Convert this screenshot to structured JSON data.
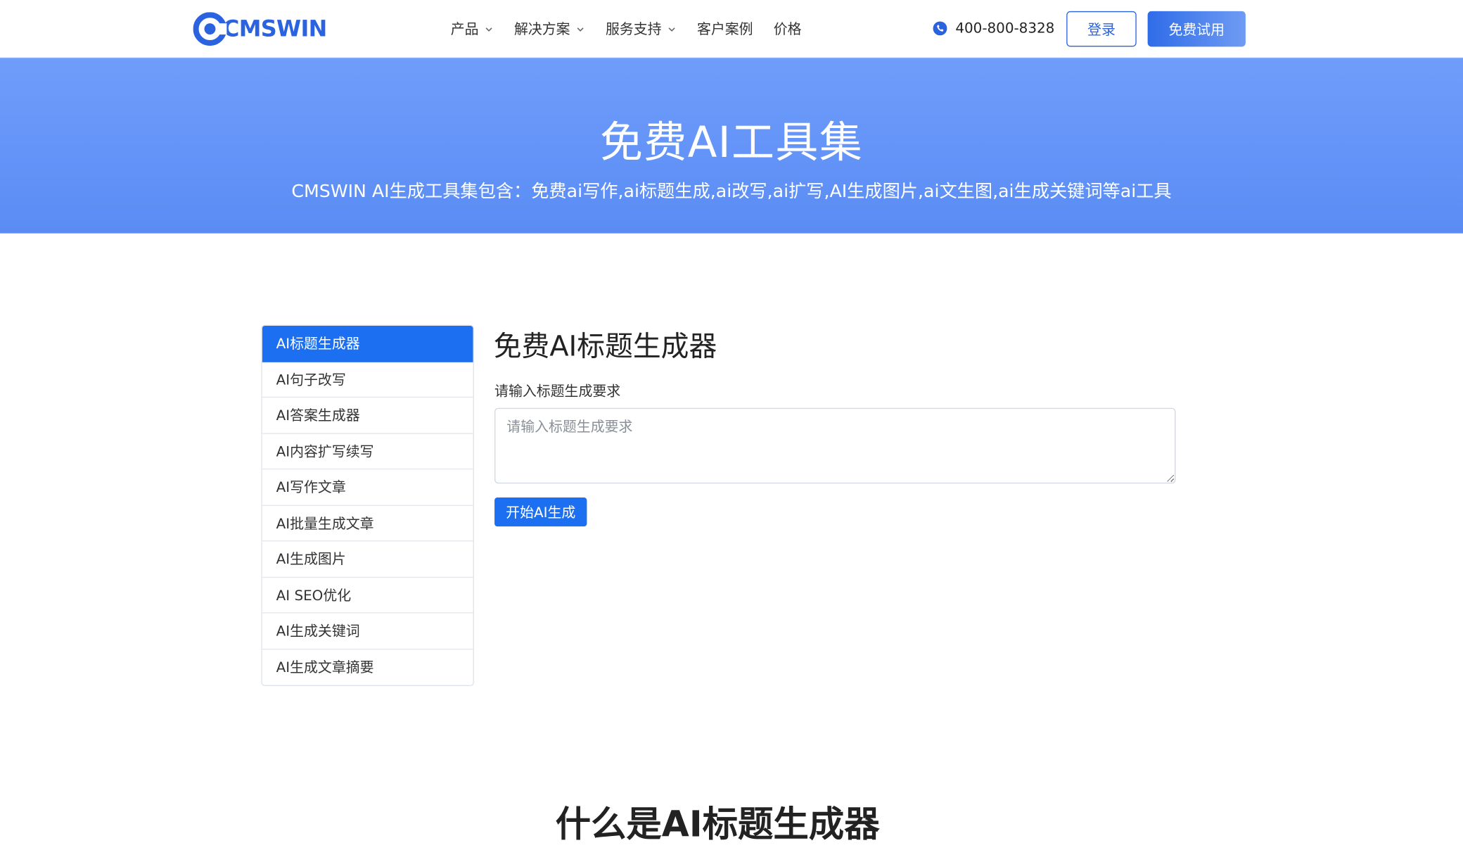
{
  "header": {
    "logo_text": "CMSWIN",
    "nav": [
      {
        "label": "产品",
        "has_dropdown": true
      },
      {
        "label": "解决方案",
        "has_dropdown": true
      },
      {
        "label": "服务支持",
        "has_dropdown": true
      },
      {
        "label": "客户案例",
        "has_dropdown": false
      },
      {
        "label": "价格",
        "has_dropdown": false
      }
    ],
    "phone": "400-800-8328",
    "login_label": "登录",
    "trial_label": "免费试用"
  },
  "hero": {
    "title": "免费AI工具集",
    "subtitle": "CMSWIN AI生成工具集包含：免费ai写作,ai标题生成,ai改写,ai扩写,AI生成图片,ai文生图,ai生成关键词等ai工具"
  },
  "sidebar": {
    "items": [
      {
        "label": "AI标题生成器",
        "active": true
      },
      {
        "label": "AI句子改写",
        "active": false
      },
      {
        "label": "AI答案生成器",
        "active": false
      },
      {
        "label": "AI内容扩写续写",
        "active": false
      },
      {
        "label": "AI写作文章",
        "active": false
      },
      {
        "label": "AI批量生成文章",
        "active": false
      },
      {
        "label": "AI生成图片",
        "active": false
      },
      {
        "label": "AI SEO优化",
        "active": false
      },
      {
        "label": "AI生成关键词",
        "active": false
      },
      {
        "label": "AI生成文章摘要",
        "active": false
      }
    ]
  },
  "main": {
    "title": "免费AI标题生成器",
    "field_label": "请输入标题生成要求",
    "input_value": "",
    "input_placeholder": "请输入标题生成要求",
    "generate_label": "开始AI生成"
  },
  "section": {
    "title": "什么是AI标题生成器"
  },
  "colors": {
    "brand": "#2a62e0",
    "active": "#1d6ff2",
    "hero_top": "#6f9dfb",
    "hero_bottom": "#5a8cf4"
  },
  "icons": {
    "logo": "cmswin-logo-icon",
    "dropdown": "chevron-down-icon",
    "phone": "phone-icon"
  }
}
